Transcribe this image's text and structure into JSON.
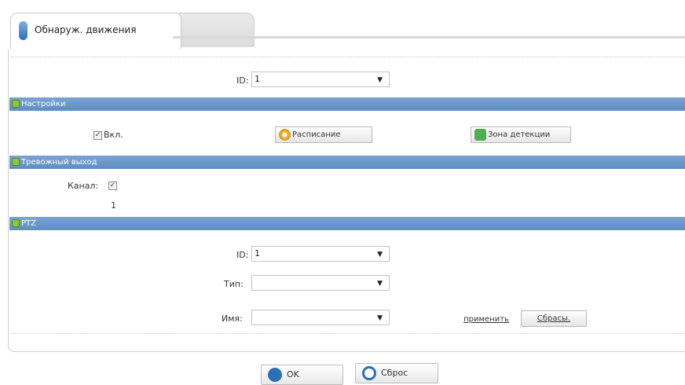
{
  "tabs": [
    {
      "label": "Обнаруж. движения",
      "active": true
    },
    {
      "label": "",
      "active": false
    }
  ],
  "top": {
    "id_label": "ID:",
    "id_value": "1"
  },
  "sections": {
    "settings": {
      "title": "Настройки"
    },
    "alarm_output": {
      "title": "Тревожный выход"
    },
    "ptz": {
      "title": "PTZ"
    }
  },
  "settings": {
    "enable_label": "Вкл.",
    "enable_checked": true,
    "schedule_button": "Расписание",
    "zone_button": "Зона детекции"
  },
  "alarm_output": {
    "channel_label": "Канал:",
    "channel_checked": true,
    "channel_number": "1"
  },
  "ptz": {
    "id_label": "ID:",
    "id_value": "1",
    "type_label": "Тип:",
    "type_value": "",
    "name_label": "Имя:",
    "name_value": "",
    "apply_button": "применить",
    "clear_button": "Сбрасы."
  },
  "footer": {
    "ok_button": "OK",
    "reset_button": "Сброс"
  },
  "colors": {
    "section_bar": "#6b97c9",
    "accent_blue": "#2c6fb6",
    "accent_green": "#8ec640"
  }
}
